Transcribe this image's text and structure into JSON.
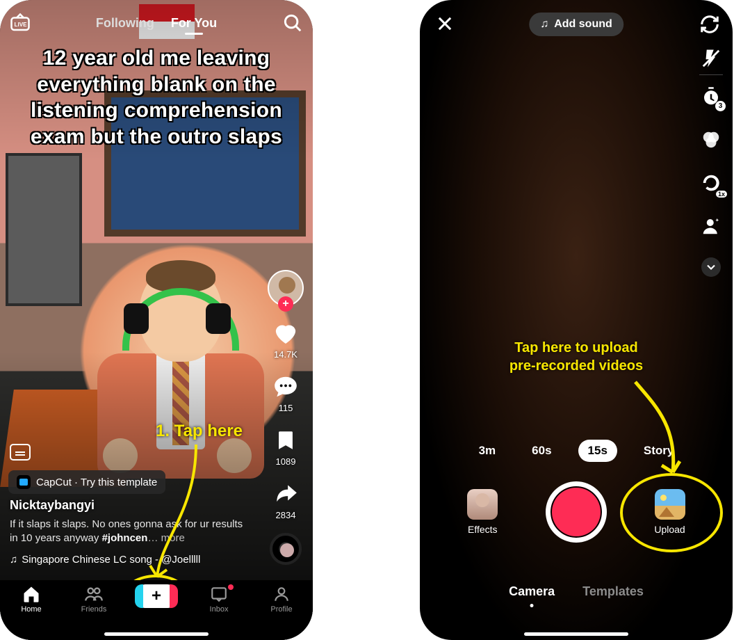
{
  "left": {
    "top_tabs": {
      "following": "Following",
      "for_you": "For You"
    },
    "caption_overlay": "12 year old me leaving everything blank on the listening comprehension exam but the outro slaps",
    "rail": {
      "likes": "14.7K",
      "comments": "115",
      "saves": "1089",
      "shares": "2834"
    },
    "capcut_pill": "CapCut · Try this template",
    "username": "Nicktaybangyi",
    "description_plain": "If it slaps it slaps. No ones gonna ask for ur results in 10 years anyway ",
    "description_hash": "#johncen",
    "description_more": "… more",
    "sound": "Singapore Chinese LC song - @Joelllll",
    "nav": {
      "home": "Home",
      "friends": "Friends",
      "inbox": "Inbox",
      "profile": "Profile"
    },
    "annotation": "1. Tap here"
  },
  "right": {
    "add_sound": "Add sound",
    "tool_badges": {
      "timer": "3",
      "speed": "1x"
    },
    "annotation_line1": "Tap here to upload",
    "annotation_line2": "pre-recorded videos",
    "durations": {
      "d3m": "3m",
      "d60s": "60s",
      "d15s": "15s",
      "story": "Story"
    },
    "labels": {
      "effects": "Effects",
      "upload": "Upload"
    },
    "modes": {
      "camera": "Camera",
      "templates": "Templates"
    }
  }
}
